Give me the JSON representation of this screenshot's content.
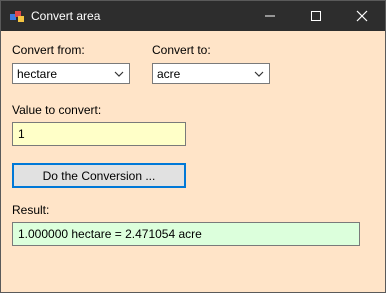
{
  "window": {
    "title": "Convert area"
  },
  "titlebar": {
    "minimize_icon": "minimize-icon",
    "maximize_icon": "maximize-icon",
    "close_icon": "close-icon",
    "bg_color": "#2d2d2d"
  },
  "form": {
    "bg_color": "#FFE4C8",
    "convert_from_label": "Convert from:",
    "convert_from_value": "hectare",
    "convert_to_label": "Convert to:",
    "convert_to_value": "acre",
    "value_label": "Value to convert:",
    "value": "1",
    "value_bg": "#FFFFC8",
    "button_label": "Do the Conversion ...",
    "result_label": "Result:",
    "result_value": "1.000000 hectare = 2.471054 acre",
    "result_bg": "#DCFFDC",
    "accent_color": "#0078d7"
  }
}
